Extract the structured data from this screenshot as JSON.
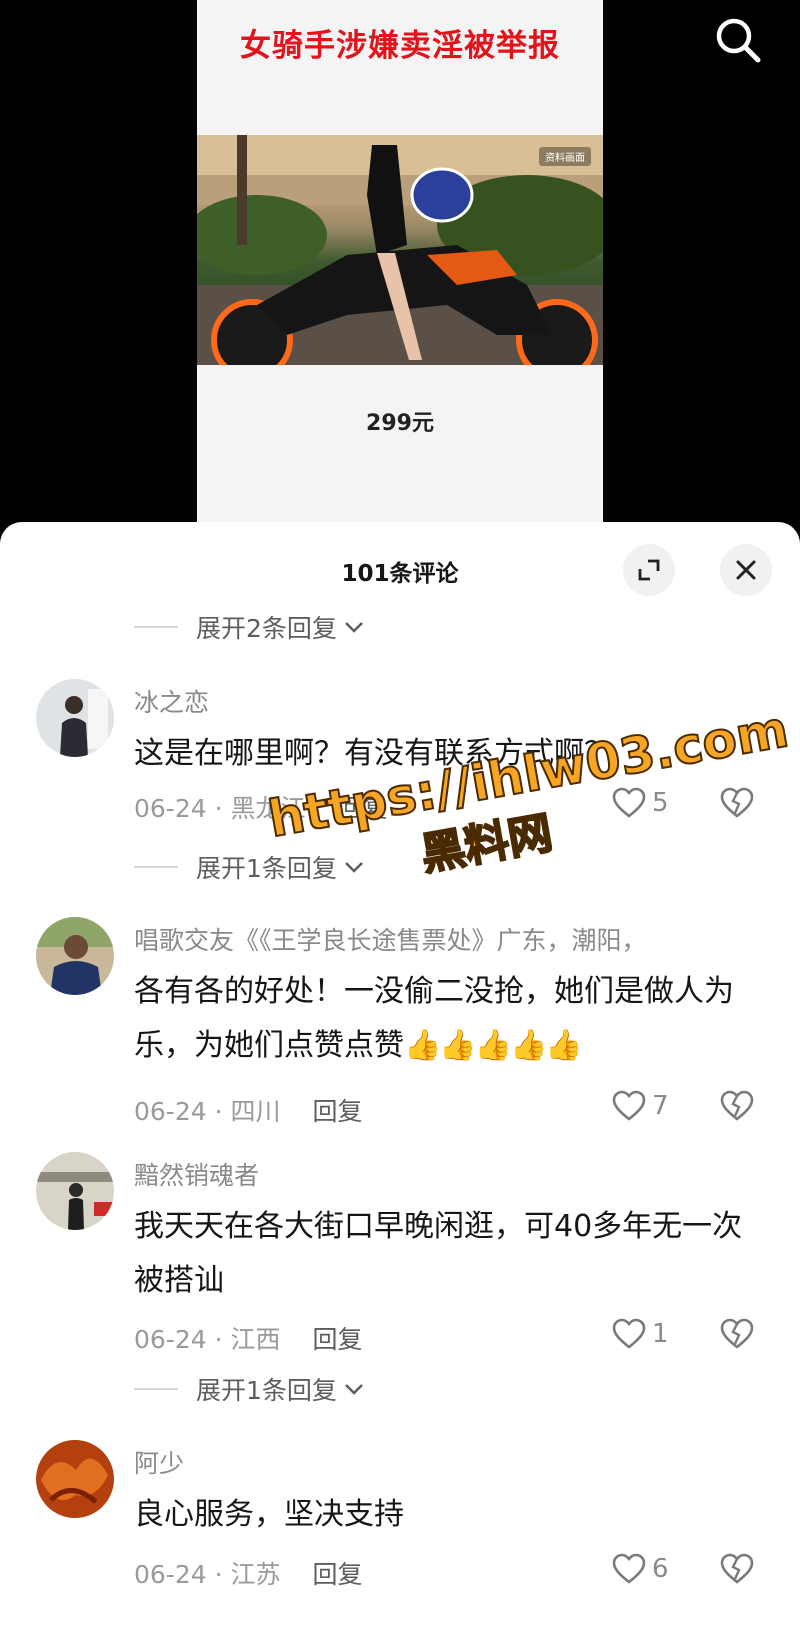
{
  "video": {
    "title": "女骑手涉嫌卖淫被举报",
    "photo_watermark": "资料画面",
    "price": "299元"
  },
  "header": {
    "search_icon": "search-icon"
  },
  "comments_panel": {
    "title": "101条评论",
    "expand_icon": "expand-icon",
    "close_icon": "close-icon",
    "toggles": [
      {
        "label": "展开2条回复"
      },
      {
        "label": "展开1条回复"
      },
      {
        "label": "展开1条回复"
      }
    ],
    "comments": [
      {
        "user": "冰之恋",
        "text": "这是在哪里啊？有没有联系方式啊？",
        "date_location": "06-24 · 黑龙江",
        "reply_label": "回复",
        "likes": "5"
      },
      {
        "user": "唱歌交友《《王学良长途售票处》广东，潮阳，",
        "text": "各有各的好处！一没偷二没抢，她们是做人为乐，为她们点赞点赞",
        "emoji": "👍👍👍👍👍",
        "date_location": "06-24 · 四川",
        "reply_label": "回复",
        "likes": "7"
      },
      {
        "user": "黯然销魂者",
        "text": "我天天在各大街口早晚闲逛，可40多年无一次被搭讪",
        "date_location": "06-24 · 江西",
        "reply_label": "回复",
        "likes": "1"
      },
      {
        "user": "阿少",
        "text": "良心服务，坚决支持",
        "date_location": "06-24 · 江苏",
        "reply_label": "回复",
        "likes": "6"
      }
    ]
  },
  "overlay_watermark": {
    "url": "https://ihlw03.com",
    "name": "黑料网"
  },
  "colors": {
    "title_red": "#e0141a",
    "sheet_bg": "#ffffff",
    "meta_gray": "#9a9a9a",
    "watermark_orange": "#f6a623"
  }
}
